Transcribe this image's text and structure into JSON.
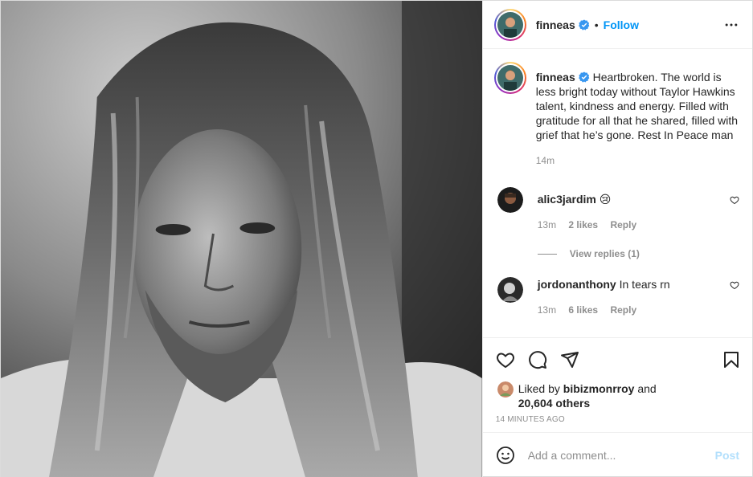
{
  "header": {
    "username": "finneas",
    "verified_icon": "verified-badge-icon",
    "dot": "•",
    "follow_label": "Follow",
    "more_icon": "more-options-icon"
  },
  "caption": {
    "username": "finneas",
    "text": "Heartbroken. The world is less bright today without Taylor Hawkins talent, kindness and energy. Filled with gratitude for all that he shared, filled with grief that he’s gone. Rest In Peace man",
    "time": "14m"
  },
  "comments": [
    {
      "username": "alic3jardim",
      "text": "😢",
      "time": "13m",
      "likes": "2 likes",
      "reply_label": "Reply"
    },
    {
      "username": "jordonanthony",
      "text": "In tears rn",
      "time": "13m",
      "likes": "6 likes",
      "reply_label": "Reply"
    }
  ],
  "view_replies": "View replies (1)",
  "likes": {
    "prefix": "Liked by",
    "user": "bibizmonrroy",
    "middle": "and",
    "count": "20,604 others"
  },
  "timestamp": "14 MINUTES AGO",
  "composer": {
    "placeholder": "Add a comment...",
    "post_label": "Post"
  },
  "colors": {
    "accent": "#0095f6",
    "post_disabled": "#b2dffc",
    "muted": "#8e8e8e"
  }
}
